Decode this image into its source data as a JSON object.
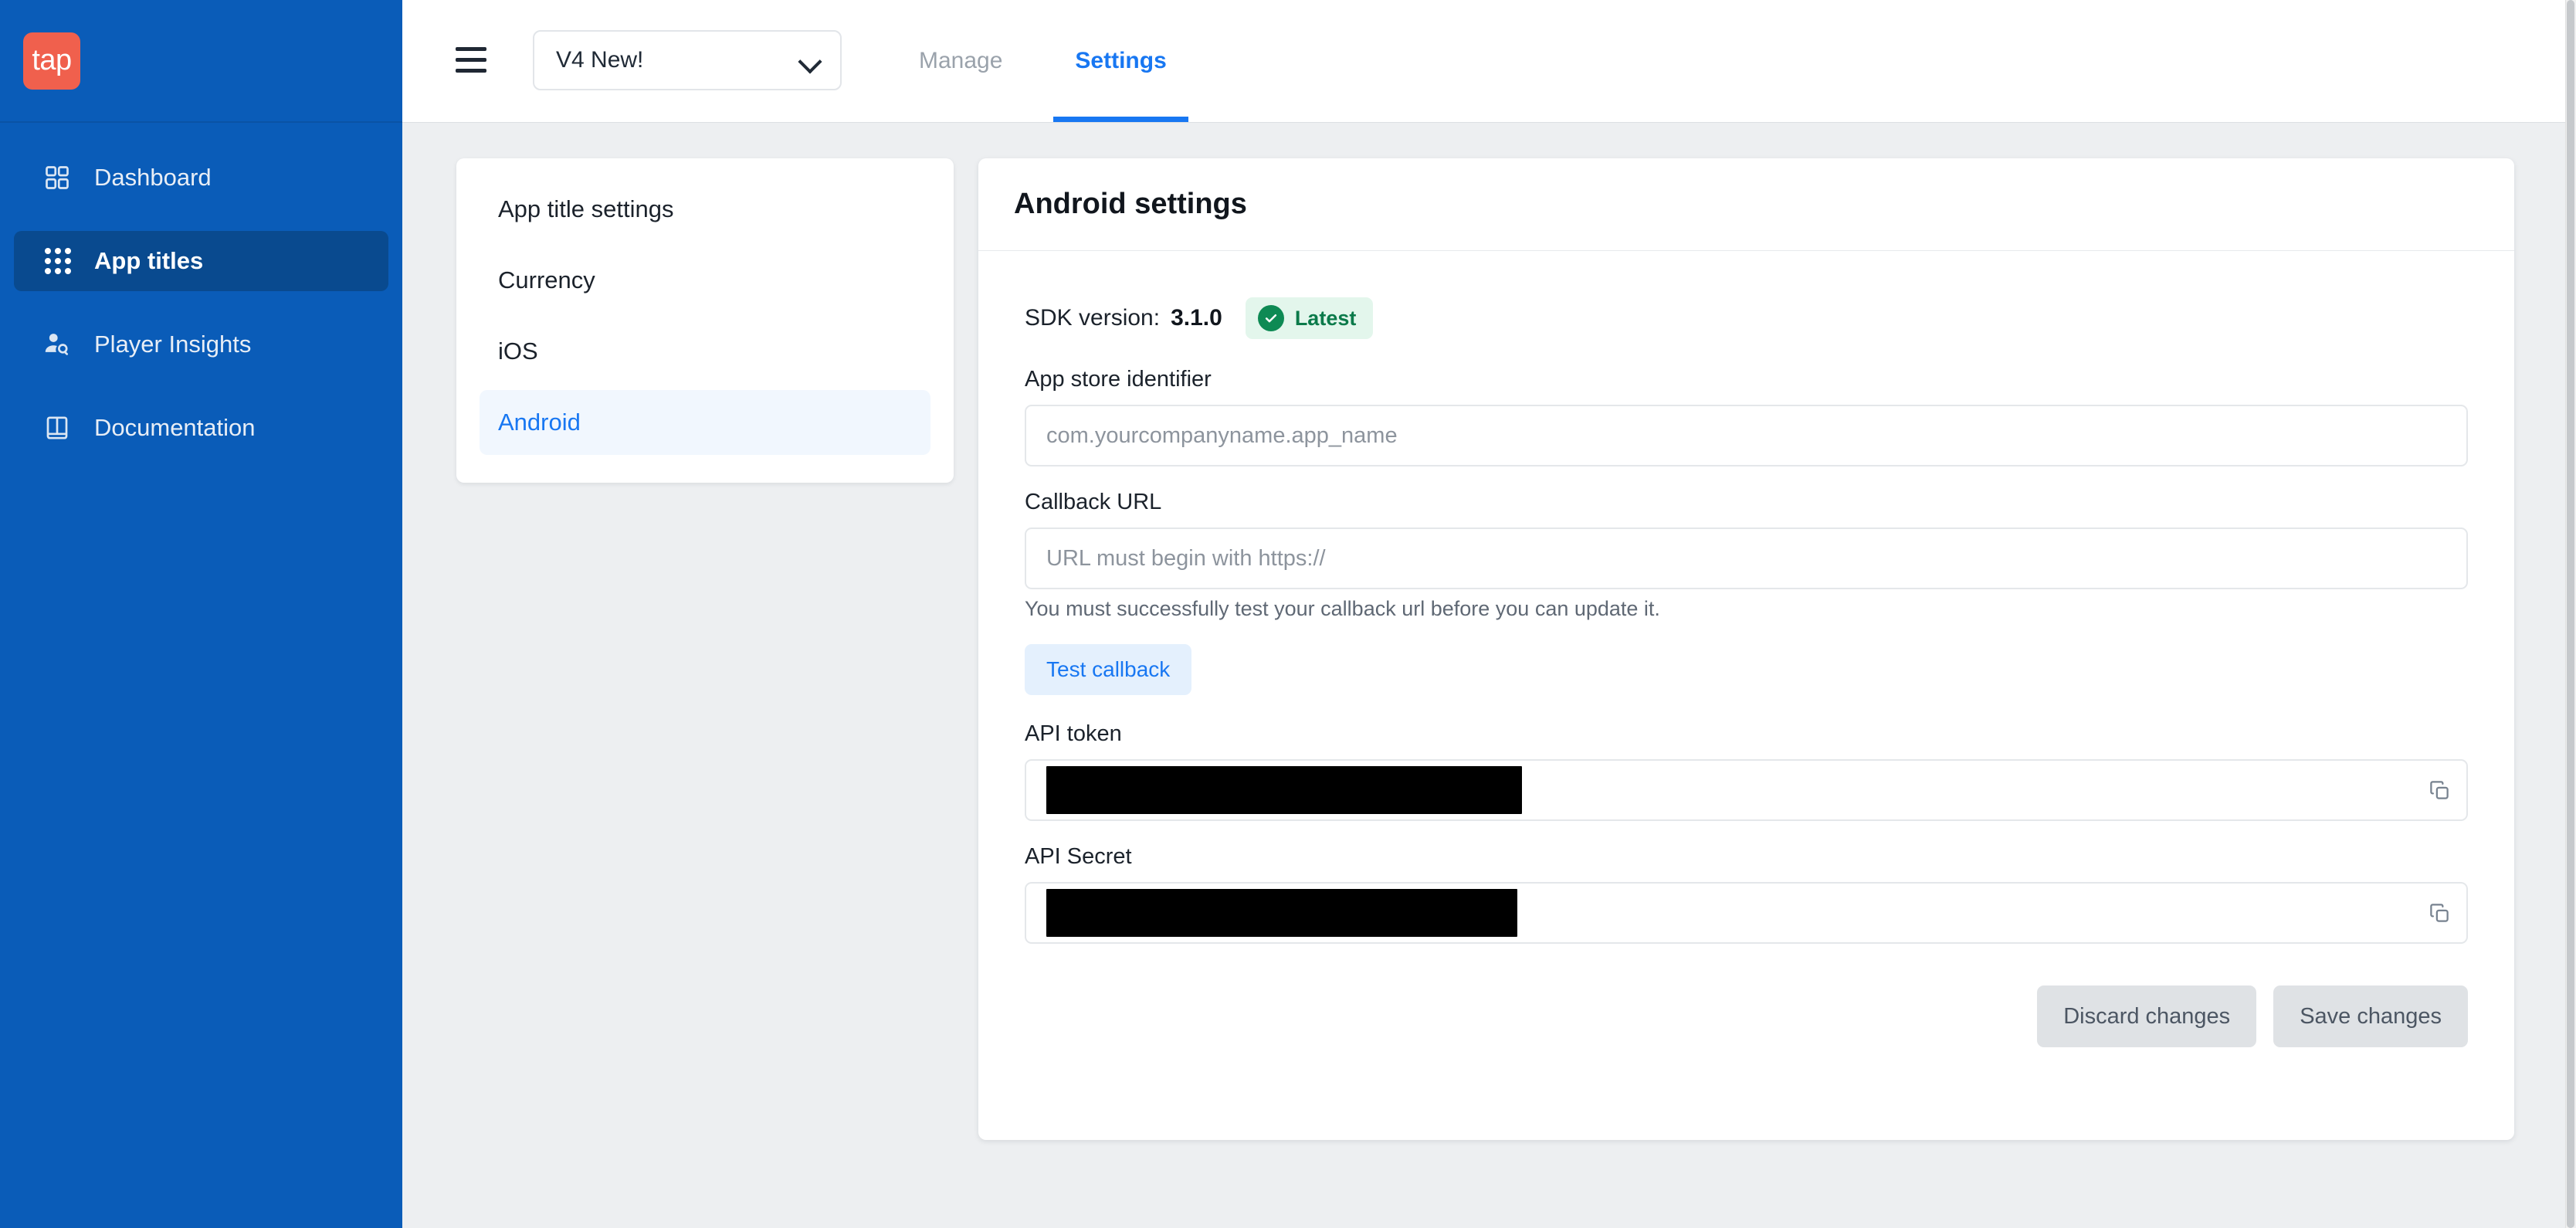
{
  "brand": {
    "logo_text": "tap",
    "logo_bg": "#f0604d",
    "sidebar_bg": "#0a5cb8",
    "sidebar_active_bg": "#094a8f",
    "accent": "#1877f2"
  },
  "sidebar": {
    "items": [
      {
        "label": "Dashboard",
        "icon": "grid-squares-icon",
        "active": false
      },
      {
        "label": "App titles",
        "icon": "dot-grid-icon",
        "active": true
      },
      {
        "label": "Player Insights",
        "icon": "person-search-icon",
        "active": false
      },
      {
        "label": "Documentation",
        "icon": "book-icon",
        "active": false
      }
    ]
  },
  "topbar": {
    "menu_icon": "hamburger-icon",
    "title_select": {
      "value": "V4 New!",
      "chevron": "chevron-down-icon"
    },
    "tabs": [
      {
        "label": "Manage",
        "active": false
      },
      {
        "label": "Settings",
        "active": true
      }
    ]
  },
  "settings_menu": {
    "items": [
      {
        "label": "App title settings",
        "active": false
      },
      {
        "label": "Currency",
        "active": false
      },
      {
        "label": "iOS",
        "active": false
      },
      {
        "label": "Android",
        "active": true
      }
    ]
  },
  "main": {
    "title": "Android settings",
    "sdk": {
      "label": "SDK version:",
      "version": "3.1.0",
      "badge_text": "Latest",
      "badge_bg": "#e3f6ec",
      "badge_fg": "#0b7a4a",
      "badge_icon": "check-circle-icon"
    },
    "fields": {
      "app_store_identifier": {
        "label": "App store identifier",
        "value": "",
        "placeholder": "com.yourcompanyname.app_name"
      },
      "callback_url": {
        "label": "Callback URL",
        "value": "",
        "placeholder": "URL must begin with https://"
      },
      "callback_hint": "You must successfully test your callback url before you can update it.",
      "test_button": "Test callback",
      "api_token": {
        "label": "API token",
        "value": "",
        "redacted": true,
        "copy_icon": "copy-icon"
      },
      "api_secret": {
        "label": "API Secret",
        "value": "",
        "redacted": true,
        "copy_icon": "copy-icon"
      }
    },
    "actions": {
      "discard": "Discard changes",
      "save": "Save changes"
    }
  }
}
